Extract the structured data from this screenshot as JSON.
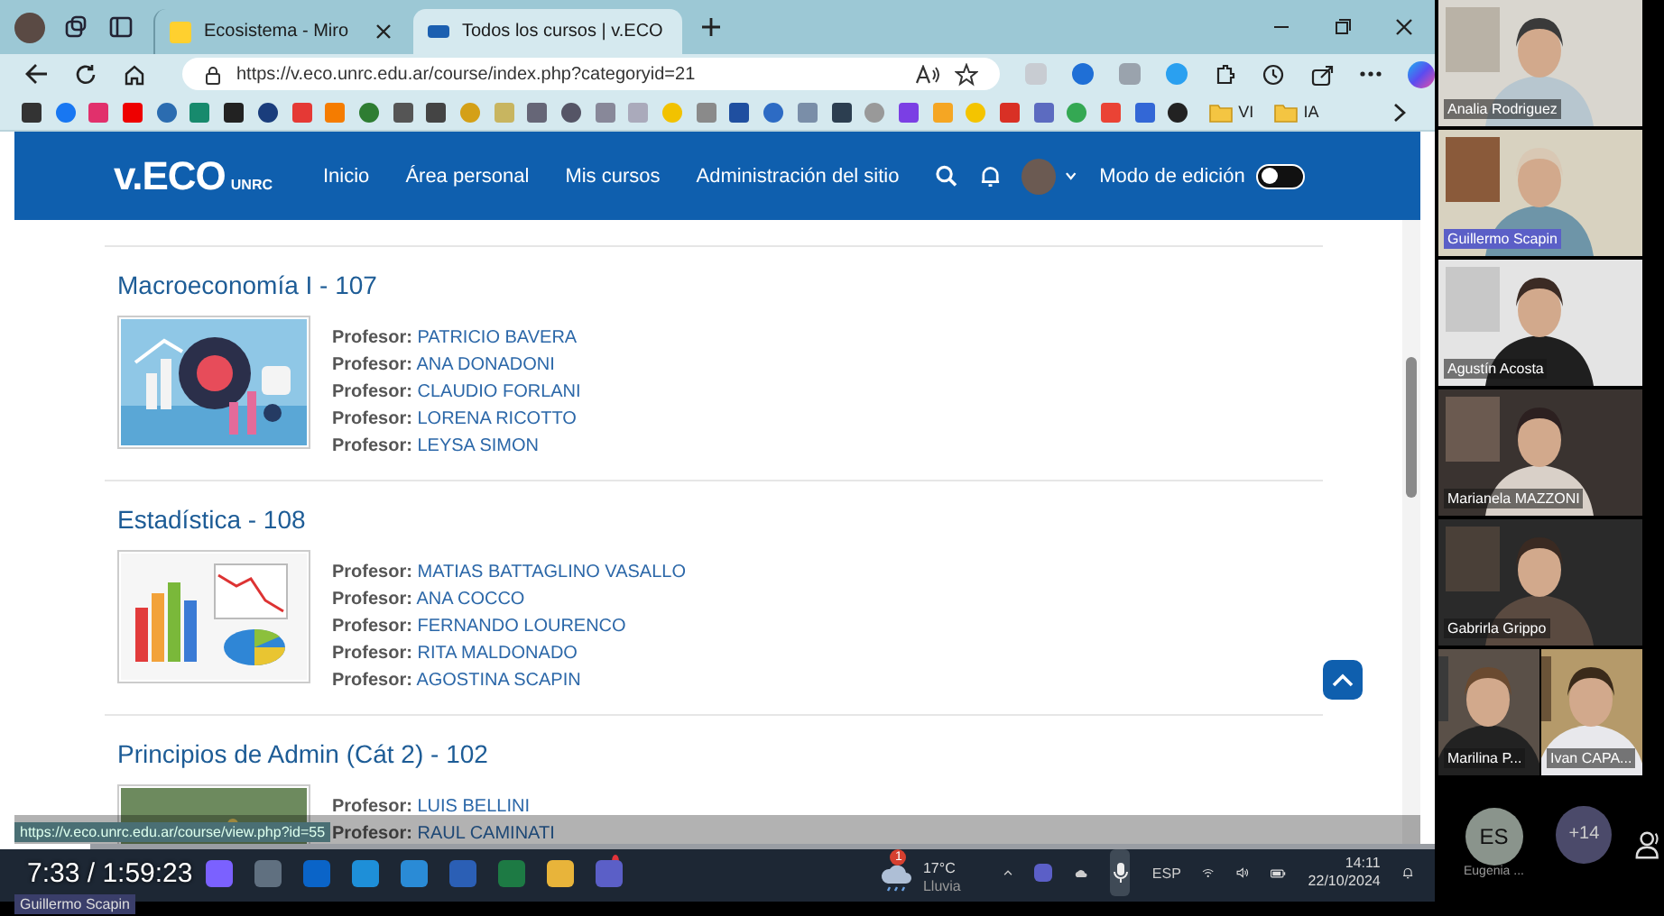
{
  "browser": {
    "tabs": [
      {
        "title": "Ecosistema - Miro",
        "selected": false
      },
      {
        "title": "Todos los cursos | v.ECO",
        "selected": true
      }
    ],
    "url": "https://v.eco.unrc.edu.ar/course/index.php?categoryid=21",
    "bookmark_folders": [
      "VI",
      "IA"
    ],
    "status_url": "https://v.eco.unrc.edu.ar/course/view.php?id=55"
  },
  "site": {
    "logo": "v.ECO",
    "logo_sub": "UNRC",
    "nav": [
      "Inicio",
      "Área personal",
      "Mis cursos",
      "Administración del sitio"
    ],
    "edit_mode_label": "Modo de edición",
    "edit_mode_on": false
  },
  "courses": [
    {
      "title": "Macroeconomía I - 107",
      "teachers": [
        {
          "role": "Profesor:",
          "name": "PATRICIO BAVERA"
        },
        {
          "role": "Profesor:",
          "name": "ANA DONADONI"
        },
        {
          "role": "Profesor:",
          "name": "CLAUDIO FORLANI"
        },
        {
          "role": "Profesor:",
          "name": "LORENA RICOTTO"
        },
        {
          "role": "Profesor:",
          "name": "LEYSA SIMON"
        }
      ]
    },
    {
      "title": "Estadística - 108",
      "teachers": [
        {
          "role": "Profesor:",
          "name": "MATIAS BATTAGLINO VASALLO"
        },
        {
          "role": "Profesor:",
          "name": "ANA COCCO"
        },
        {
          "role": "Profesor:",
          "name": "FERNANDO LOURENCO"
        },
        {
          "role": "Profesor:",
          "name": "RITA MALDONADO"
        },
        {
          "role": "Profesor:",
          "name": "AGOSTINA SCAPIN"
        }
      ]
    },
    {
      "title": "Principios de Admin (Cát 2) - 102",
      "teachers": [
        {
          "role": "Profesor:",
          "name": "LUIS BELLINI"
        },
        {
          "role": "Profesor:",
          "name": "RAUL CAMINATI"
        }
      ]
    }
  ],
  "participants": [
    {
      "name": "Analia Rodriguez",
      "active_speaker": false
    },
    {
      "name": "Guillermo Scapin",
      "active_speaker": true
    },
    {
      "name": "Agustín Acosta",
      "active_speaker": false
    },
    {
      "name": "Marianela MAZZONI",
      "active_speaker": false
    },
    {
      "name": "Gabrirla Grippo",
      "active_speaker": false
    },
    {
      "name": "Marilina P...",
      "active_speaker": false
    },
    {
      "name": "Ivan CAPA...",
      "active_speaker": false
    }
  ],
  "more_participants": {
    "initials": "ES",
    "name": "Eugenia ...",
    "count": "+14"
  },
  "player": {
    "time": "7:33 / 1:59:23",
    "presenter": "Guillermo Scapin",
    "level": 0.063
  },
  "taskbar": {
    "weather_badge": "1",
    "temperature": "17°C",
    "weather": "Lluvia",
    "language": "ESP",
    "time": "14:11",
    "date": "22/10/2024"
  }
}
